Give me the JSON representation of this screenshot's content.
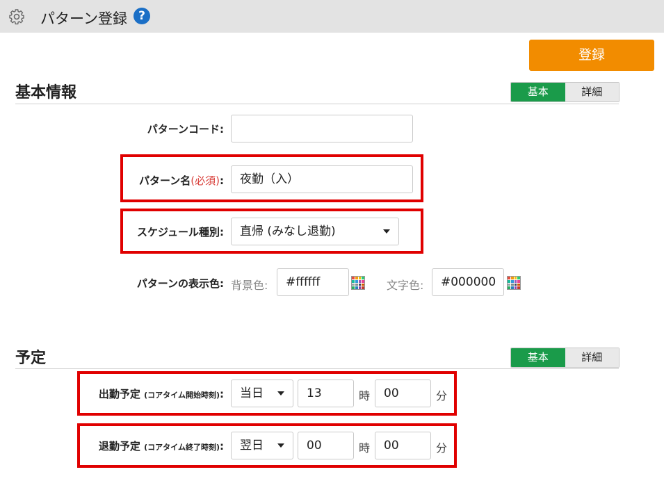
{
  "header": {
    "title": "パターン登録",
    "help_icon": "?"
  },
  "actions": {
    "register_label": "登録"
  },
  "basic_section": {
    "title": "基本情報",
    "toggle": {
      "basic": "基本",
      "detail": "詳細"
    },
    "pattern_code": {
      "label": "パターンコード:",
      "value": ""
    },
    "pattern_name": {
      "label": "パターン名",
      "required": "(必須)",
      "suffix": ":",
      "value": "夜勤（入）"
    },
    "schedule_type": {
      "label": "スケジュール種別:",
      "selected": "直帰 (みなし退勤)"
    },
    "display_color": {
      "label": "パターンの表示色:",
      "background_label": "背景色:",
      "background_value": "#ffffff",
      "text_label": "文字色:",
      "text_value": "#000000"
    }
  },
  "schedule_section": {
    "title": "予定",
    "toggle": {
      "basic": "基本",
      "detail": "詳細"
    },
    "clock_in": {
      "label": "出勤予定",
      "sub": "(コアタイム開始時刻)",
      "suffix": ":",
      "day": "当日",
      "hour": "13",
      "hour_unit": "時",
      "minute": "00",
      "minute_unit": "分"
    },
    "clock_out": {
      "label": "退勤予定",
      "sub": "(コアタイム終了時刻)",
      "suffix": ":",
      "day": "翌日",
      "hour": "00",
      "hour_unit": "時",
      "minute": "00",
      "minute_unit": "分"
    }
  }
}
